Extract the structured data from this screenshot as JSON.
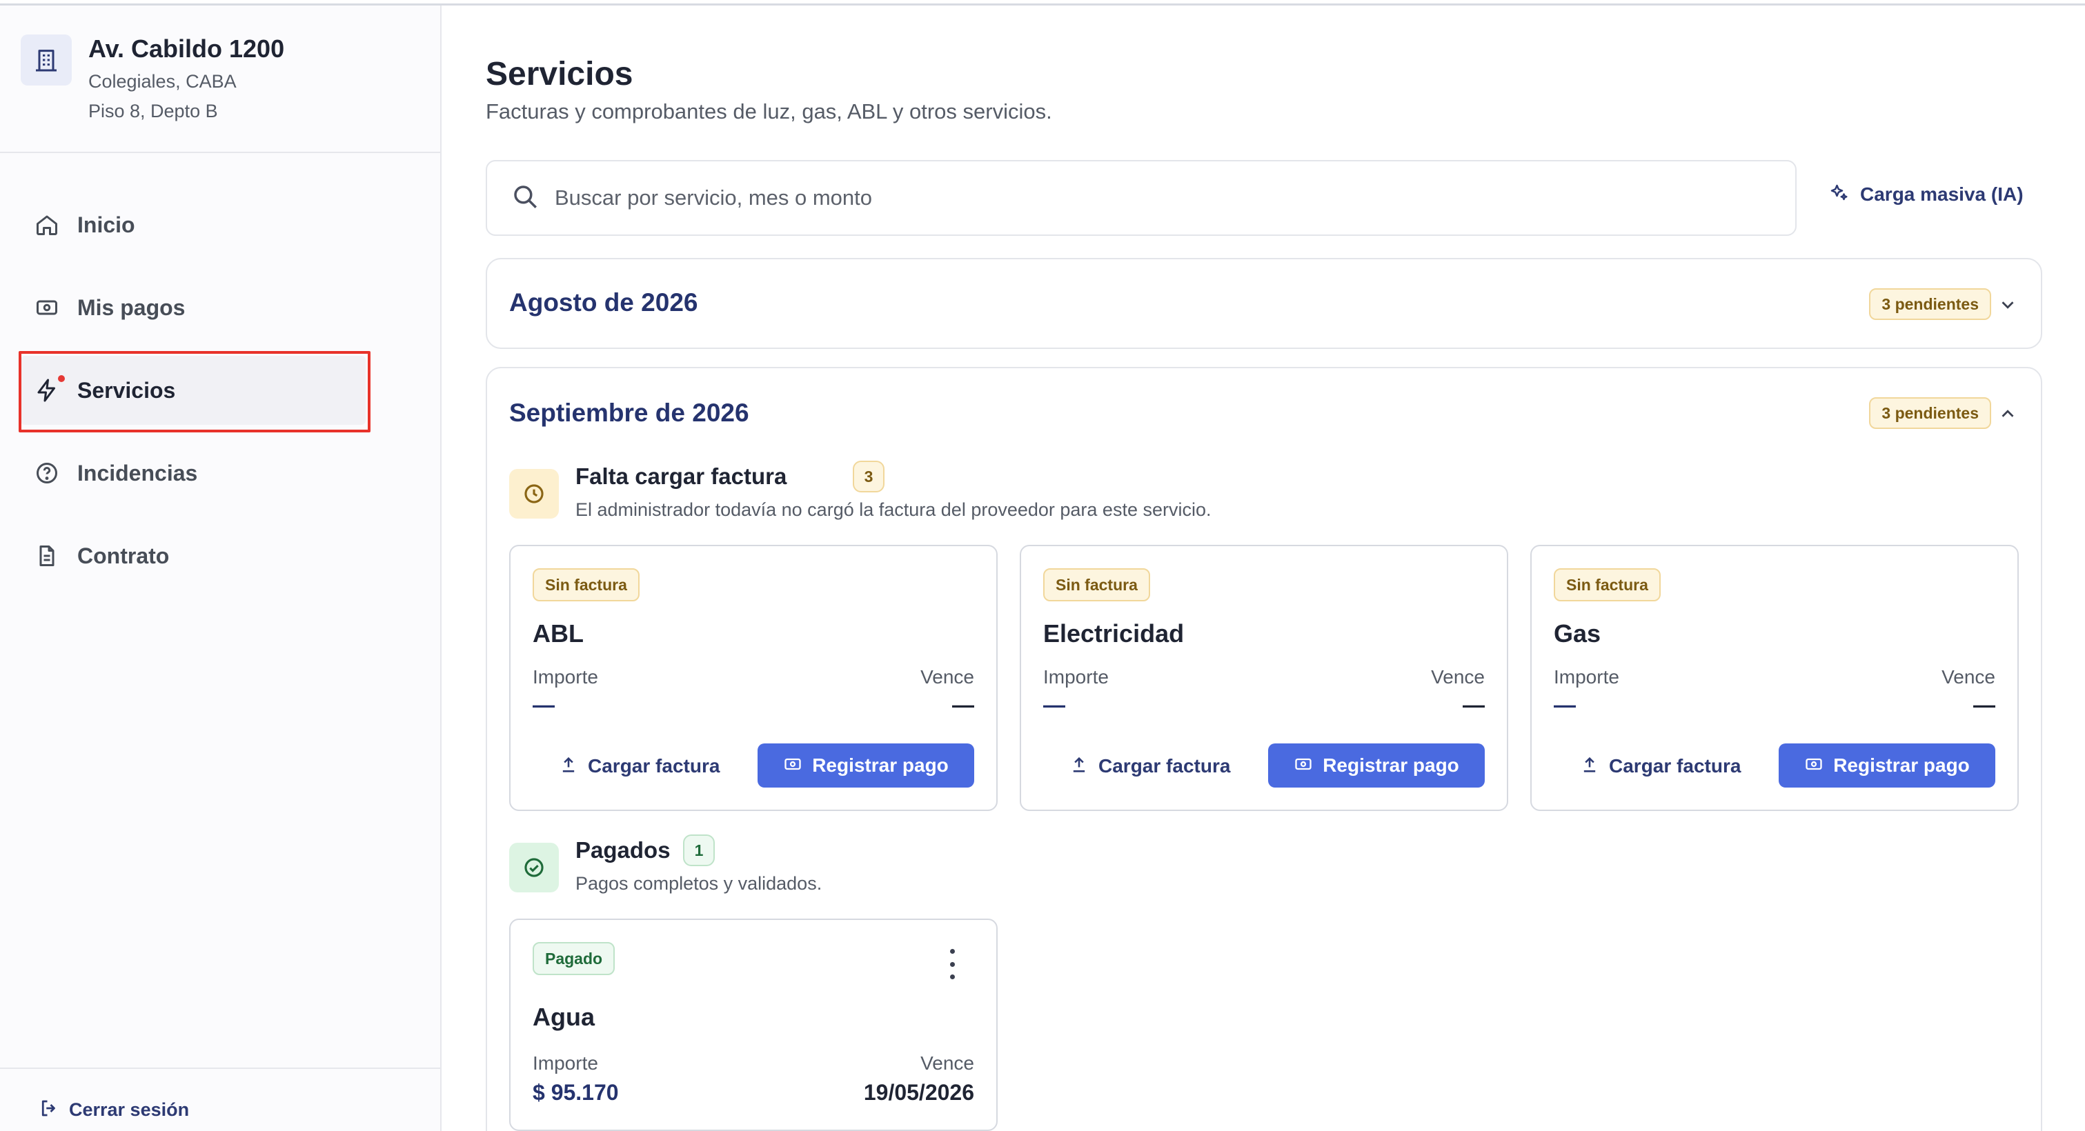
{
  "property": {
    "title": "Av. Cabildo 1200",
    "line1": "Colegiales, CABA",
    "line2": "Piso 8, Depto B",
    "icon": "building-icon"
  },
  "nav": {
    "items": [
      {
        "label": "Inicio",
        "icon": "home-icon"
      },
      {
        "label": "Mis pagos",
        "icon": "money-icon"
      },
      {
        "label": "Servicios",
        "icon": "bolt-icon",
        "active": true
      },
      {
        "label": "Incidencias",
        "icon": "help-circle-icon"
      },
      {
        "label": "Contrato",
        "icon": "document-icon"
      }
    ],
    "logout": "Cerrar sesión"
  },
  "page": {
    "title": "Servicios",
    "subtitle": "Facturas y comprobantes de luz, gas, ABL y otros servicios."
  },
  "search": {
    "placeholder": "Buscar por servicio, mes o monto"
  },
  "bulk_upload": "Carga masiva (IA)",
  "months": [
    {
      "title": "Agosto de 2026",
      "badge": "3 pendientes",
      "expanded": false
    },
    {
      "title": "Septiembre de 2026",
      "badge": "3 pendientes",
      "expanded": true
    }
  ],
  "groups": {
    "pending": {
      "title": "Falta cargar factura",
      "count": "3",
      "description": "El administrador todavía no cargó la factura del proveedor para este servicio."
    },
    "paid": {
      "title": "Pagados",
      "count": "1",
      "description": "Pagos completos y validados."
    }
  },
  "labels": {
    "amount": "Importe",
    "due": "Vence",
    "upload": "Cargar factura",
    "pay": "Registrar pago"
  },
  "services": [
    {
      "badge": "Sin factura",
      "name": "ABL",
      "amount": "—",
      "due": "—"
    },
    {
      "badge": "Sin factura",
      "name": "Electricidad",
      "amount": "—",
      "due": "—"
    },
    {
      "badge": "Sin factura",
      "name": "Gas",
      "amount": "—",
      "due": "—"
    }
  ],
  "paid_services": [
    {
      "badge": "Pagado",
      "name": "Agua",
      "amount": "$ 95.170",
      "due": "19/05/2026"
    }
  ],
  "colors": {
    "accent": "#4a6ae0",
    "navy": "#25336e",
    "pending_bg": "#fdf5df",
    "paid_bg": "#eef9f1",
    "highlight": "#e8322a"
  }
}
